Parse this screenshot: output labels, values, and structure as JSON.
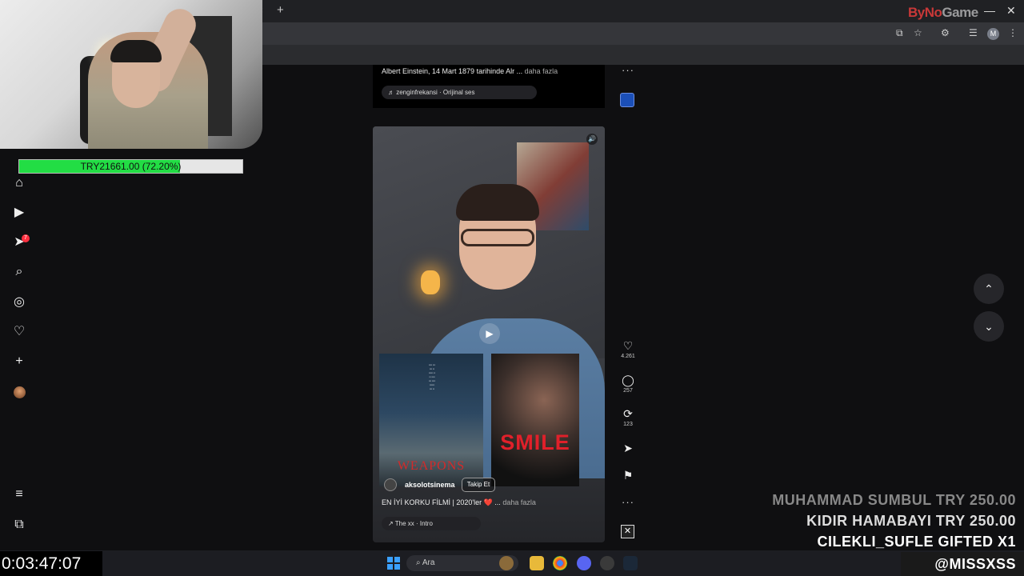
{
  "browser": {
    "tab_close": "×",
    "tab_new": "+",
    "window_min": "—",
    "window_close": "✕",
    "profile_initial": "M"
  },
  "watermark": {
    "brand_a": "ByNo",
    "brand_b": "Game"
  },
  "donation_bar": {
    "label": "TRY21661.00 (72.20%)",
    "progress": 0.722,
    "fill_color": "#22dd44"
  },
  "sidebar": {
    "notifications_count": "7",
    "items": [
      {
        "icon": "home-icon",
        "glyph": "⌂"
      },
      {
        "icon": "reels-icon",
        "glyph": "▶"
      },
      {
        "icon": "direct-icon",
        "glyph": "➤"
      },
      {
        "icon": "search-icon",
        "glyph": "⌕"
      },
      {
        "icon": "explore-icon",
        "glyph": "◎"
      },
      {
        "icon": "heart-icon",
        "glyph": "♡"
      },
      {
        "icon": "create-icon",
        "glyph": "+"
      },
      {
        "icon": "menu-icon",
        "glyph": "≡"
      },
      {
        "icon": "apps-icon",
        "glyph": "⧉"
      }
    ]
  },
  "prev_reel": {
    "caption": "Albert Einstein, 14 Mart 1879 tarihinde Alr ...",
    "more": " daha fazla",
    "audio": "♬ zenginfrekansi · Orijinal ses"
  },
  "reel": {
    "username": "aksolotsinema",
    "follow_label": "Takip Et",
    "caption": "EN İYİ KORKU FİLMİ | 2020'ler ❤️ ...",
    "more": " daha fazla",
    "audio": "↗ The xx · Intro",
    "poster_left_title": "WEAPONS",
    "poster_right_title": "SMILE",
    "mute_glyph": "🔊",
    "play_glyph": "▶"
  },
  "actions": {
    "likes": "4.261",
    "comments": "257",
    "reposts": "123",
    "more": "···",
    "close": "✕"
  },
  "nav": {
    "up": "⌃",
    "down": "⌄"
  },
  "overlay": {
    "line1": "MUHAMMAD SUMBUL  TRY 250.00",
    "line2": "KIDIR HAMABAYI  TRY 250.00",
    "line3": "CILEKLI_SUFLE  GIFTED X1",
    "sub": "@MISSXSS  SUB"
  },
  "timer": "0:03:47:07",
  "taskbar": {
    "search_placeholder": "⌕   Ara"
  }
}
